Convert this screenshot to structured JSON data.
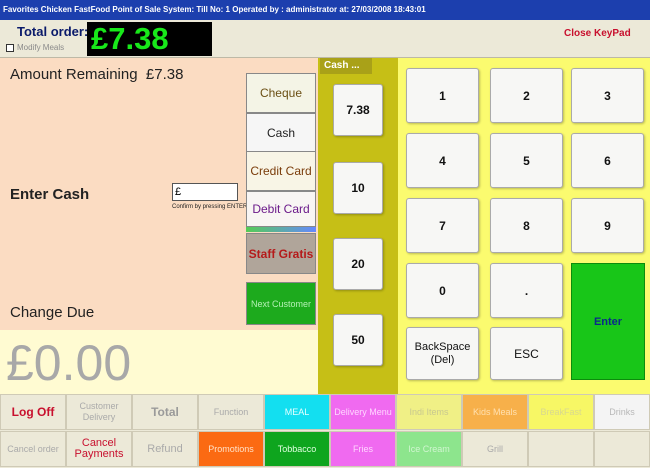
{
  "title": "Favorites Chicken FastFood Point of Sale System:  Till No: 1 Operated by : administrator at:  27/03/2008 18:43:01",
  "header": {
    "total_label": "Total order:",
    "modify_label": "Modify Meals",
    "total_amount": "£7.38",
    "close_keypad": "Close KeyPad"
  },
  "payment": {
    "amount_remaining_label": "Amount Remaining",
    "amount_remaining_value": "£7.38",
    "enter_cash_label": "Enter Cash",
    "cash_input_value": "£",
    "confirm_hint": "Confirm by pressing ENTER",
    "change_due_label": "Change Due",
    "change_due_value": "£0.00",
    "methods": [
      "Cheque",
      "Cash",
      "Credit Card",
      "Debit Card",
      "Staff Gratis",
      "Next Customer"
    ]
  },
  "cash_column": {
    "header": "Cash ...",
    "buttons": [
      "7.38",
      "10",
      "20",
      "50"
    ]
  },
  "keypad": {
    "keys": [
      "1",
      "2",
      "3",
      "4",
      "5",
      "6",
      "7",
      "8",
      "9",
      "0",
      "."
    ],
    "backspace": "BackSpace (Del)",
    "esc": "ESC",
    "enter": "Enter"
  },
  "bottom_row1": [
    "Log Off",
    "Customer Delivery",
    "Total",
    "Function",
    "MEAL",
    "Delivery Menu",
    "Indi Items",
    "Kids Meals",
    "BreakFast",
    "Drinks"
  ],
  "bottom_row2": [
    "Cancel order",
    "Cancel Payments",
    "Refund",
    "Promotions",
    "Tobbacco",
    "Fries",
    "Ice Cream",
    "Grill",
    "",
    ""
  ],
  "colors": {
    "title_bar": "#1c3fae",
    "total_amount_text": "#18e81a",
    "payment_panel": "#fbdcc2",
    "cash_column": "#c6bf16",
    "keypad_panel": "#fbfb6f",
    "enter_key": "#18c618"
  }
}
